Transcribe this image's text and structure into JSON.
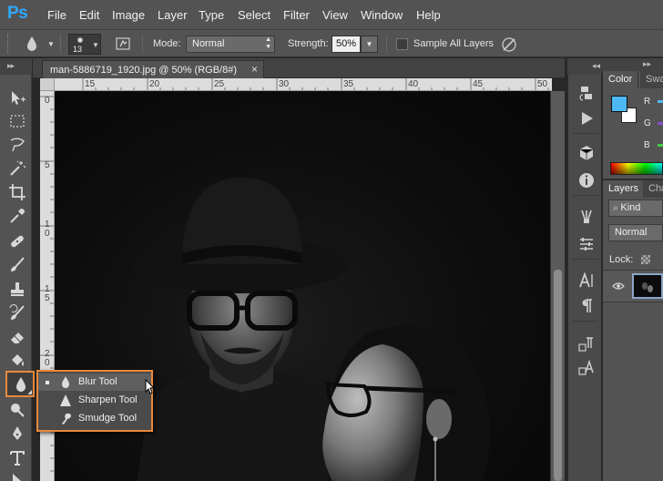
{
  "app": {
    "logo_text": "Ps"
  },
  "menu": {
    "items": [
      "File",
      "Edit",
      "Image",
      "Layer",
      "Type",
      "Select",
      "Filter",
      "View",
      "Window",
      "Help"
    ]
  },
  "options_bar": {
    "brush_size": "13",
    "mode_label": "Mode:",
    "mode_value": "Normal",
    "strength_label": "Strength:",
    "strength_value": "50%",
    "sample_all_layers_label": "Sample All Layers",
    "sample_all_layers_checked": false
  },
  "document": {
    "tab_title": "man-5886719_1920.jpg @ 50% (RGB/8#)",
    "close_glyph": "×"
  },
  "rulers": {
    "horizontal_labels": [
      "15",
      "20",
      "25",
      "30",
      "35",
      "40",
      "45",
      "50"
    ],
    "vertical_labels": [
      "0",
      "5",
      "1\n0",
      "1\n5",
      "2\n0"
    ]
  },
  "tools": [
    "move-tool",
    "marquee-tool",
    "lasso-tool",
    "quick-selection-tool",
    "crop-tool",
    "eyedropper-tool",
    "healing-brush-tool",
    "brush-tool",
    "clone-stamp-tool",
    "history-brush-tool",
    "eraser-tool",
    "paint-bucket-tool",
    "blur-tool",
    "dodge-tool",
    "pen-tool",
    "type-tool",
    "path-selection-tool"
  ],
  "flyout": {
    "items": [
      {
        "label": "Blur Tool",
        "icon": "blur-drop-icon",
        "selected": true
      },
      {
        "label": "Sharpen Tool",
        "icon": "sharpen-triangle-icon",
        "selected": false
      },
      {
        "label": "Smudge Tool",
        "icon": "smudge-finger-icon",
        "selected": false
      }
    ]
  },
  "color_panel": {
    "tabs": [
      "Color",
      "Swa"
    ],
    "channels": [
      "R",
      "G",
      "B"
    ],
    "foreground": "#4cb8f5",
    "background": "#ffffff"
  },
  "layers_panel": {
    "tabs": [
      "Layers",
      "Cha"
    ],
    "filter_label": "Kind",
    "blend_mode": "Normal",
    "lock_label": "Lock:"
  },
  "colors": {
    "accent_orange": "#e8883a",
    "ps_blue": "#31a8ff",
    "ui_gray": "#535353"
  }
}
